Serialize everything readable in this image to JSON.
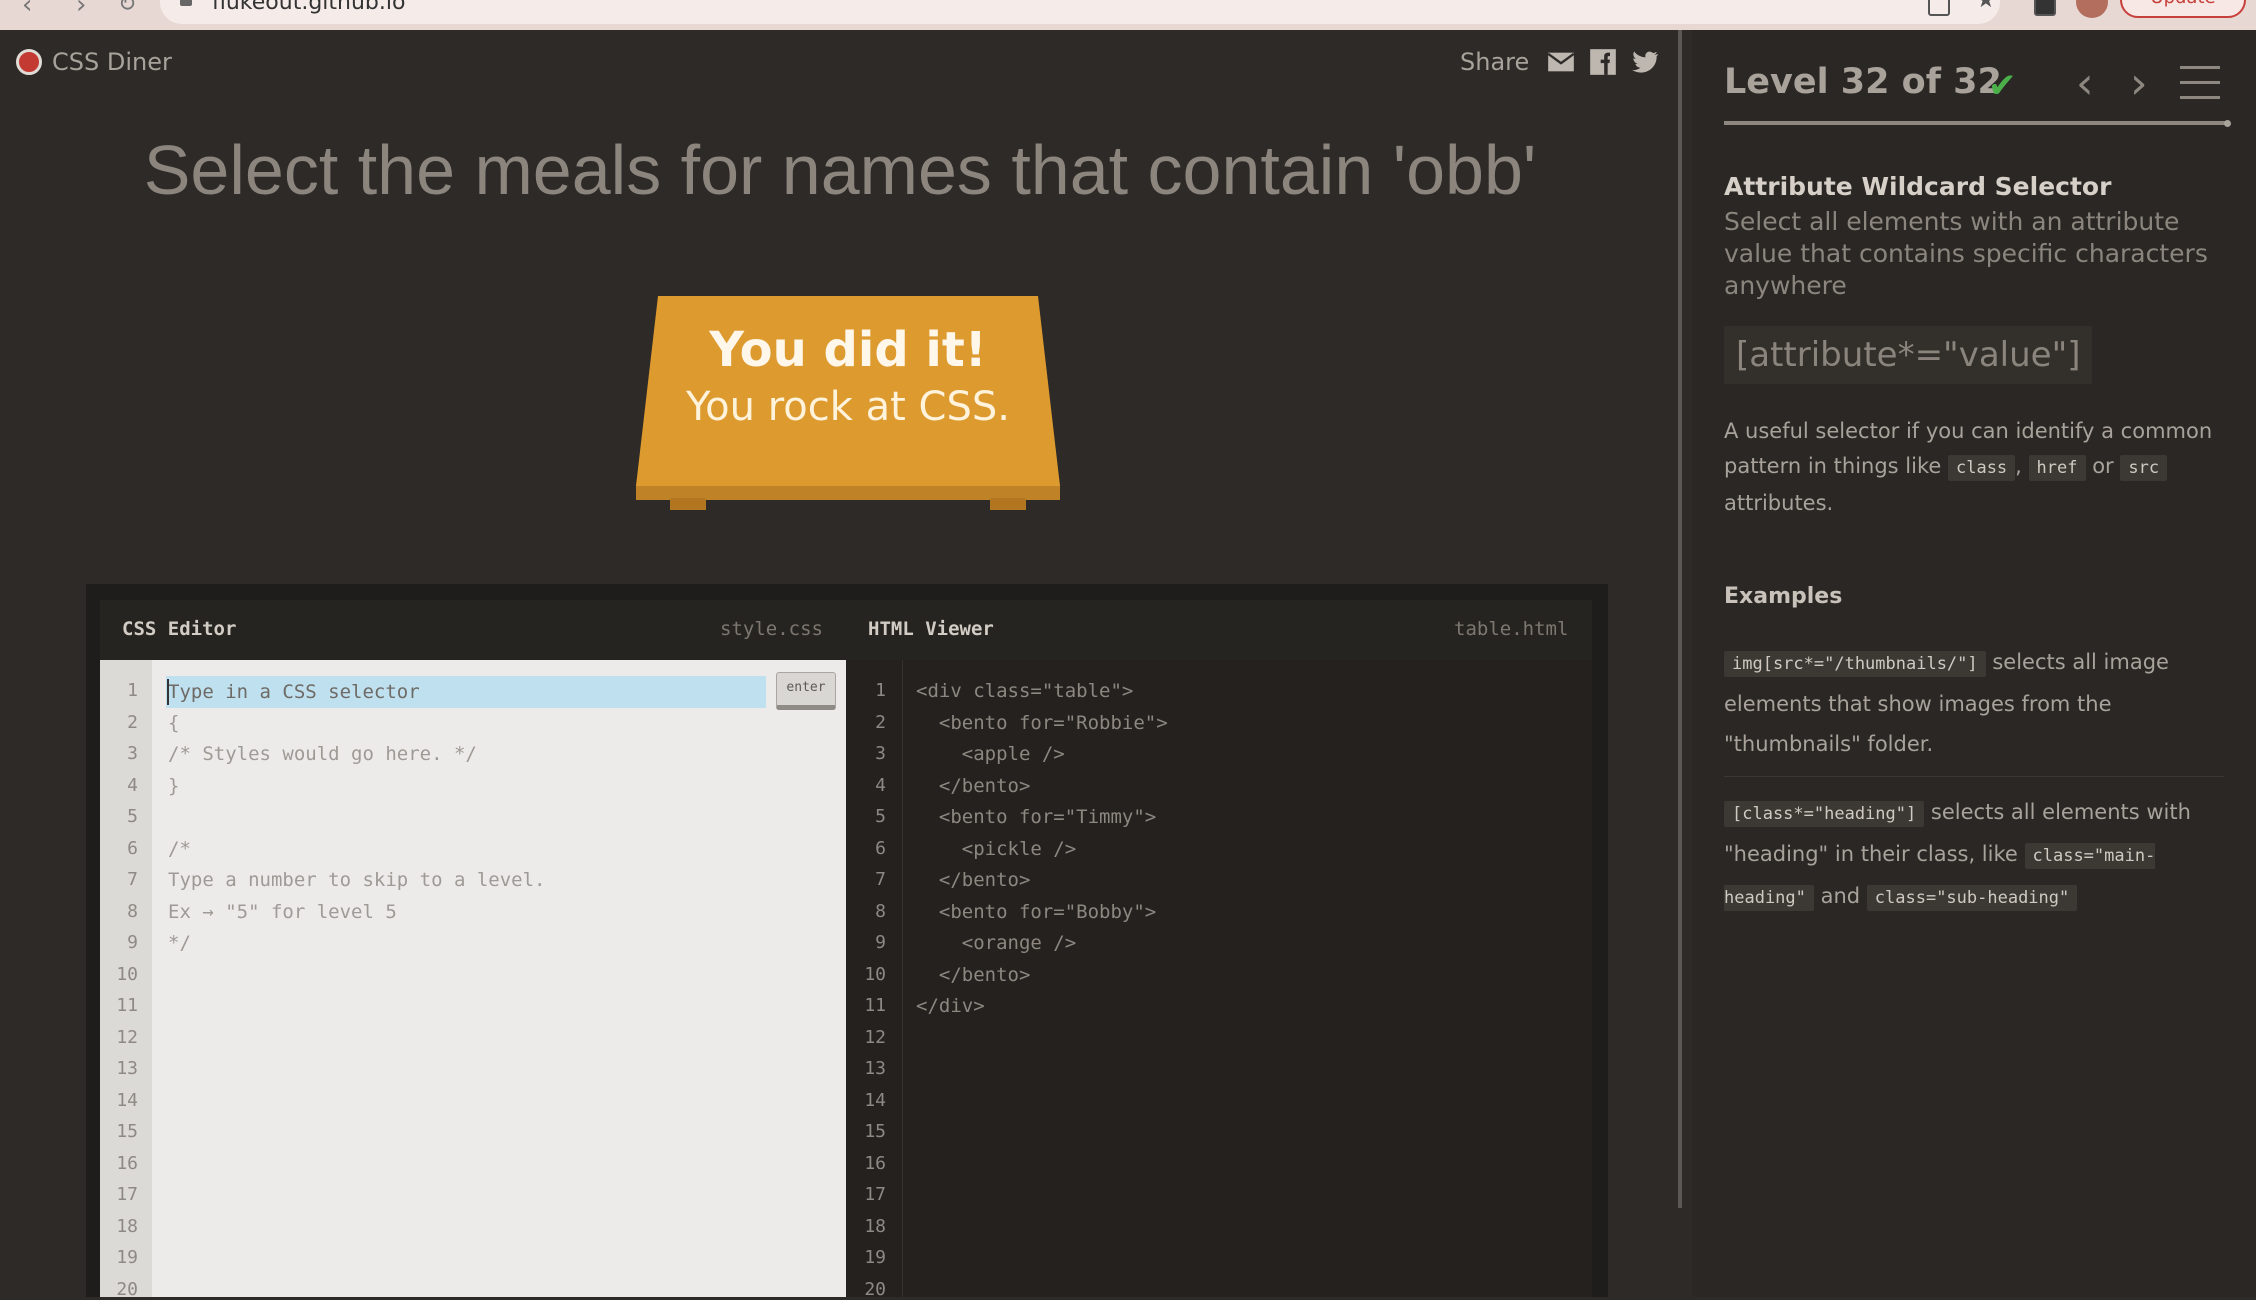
{
  "browser": {
    "url": "flukeout.github.io",
    "update_label": "Update"
  },
  "app": {
    "brand": "CSS Diner",
    "share_label": "Share"
  },
  "order": "Select the meals for names that contain 'obb'",
  "win": {
    "title": "You did it!",
    "subtitle": "You rock at CSS."
  },
  "editor": {
    "css_title": "CSS Editor",
    "css_file": "style.css",
    "html_title": "HTML Viewer",
    "html_file": "table.html",
    "input_placeholder": "Type in a CSS selector",
    "enter_label": "enter",
    "css_lines": [
      "{",
      "/* Styles would go here. */",
      "}",
      "",
      "/*",
      "Type a number to skip to a level.",
      "Ex → \"5\" for level 5",
      "*/"
    ],
    "html_lines": [
      "<div class=\"table\">",
      "  <bento for=\"Robbie\">",
      "    <apple />",
      "  </bento>",
      "  <bento for=\"Timmy\">",
      "    <pickle />",
      "  </bento>",
      "  <bento for=\"Bobby\">",
      "    <orange />",
      "  </bento>",
      "</div>"
    ],
    "line_numbers": [
      "1",
      "2",
      "3",
      "4",
      "5",
      "6",
      "7",
      "8",
      "9",
      "10",
      "11",
      "12",
      "13",
      "14",
      "15",
      "16",
      "17",
      "18",
      "19",
      "20"
    ]
  },
  "sidebar": {
    "level_label": "Level 32 of 32",
    "check": "✔",
    "selector_name": "Attribute Wildcard Selector",
    "selector_title": "Select all elements with an attribute value that contains specific characters anywhere",
    "syntax": "[attribute*=\"value\"]",
    "hint_pre": "A useful selector if you can identify a common pattern in things like",
    "hint_tag1": "class",
    "hint_sep1": ",",
    "hint_tag2": "href",
    "hint_sep2": "or",
    "hint_tag3": "src",
    "hint_post": "attributes.",
    "examples_title": "Examples",
    "examples": [
      {
        "code": "img[src*=\"/thumbnails/\"]",
        "text": "selects all image elements that show images from the \"thumbnails\" folder."
      },
      {
        "code": "[class*=\"heading\"]",
        "text": "selects all elements with \"heading\" in their class, like",
        "code2": "class=\"main-heading\"",
        "and": "and",
        "code3": "class=\"sub-heading\""
      }
    ]
  },
  "colors": {
    "background": "#2d2a27",
    "table_orange": "#dd9a2f",
    "success_green": "#4bb049"
  }
}
